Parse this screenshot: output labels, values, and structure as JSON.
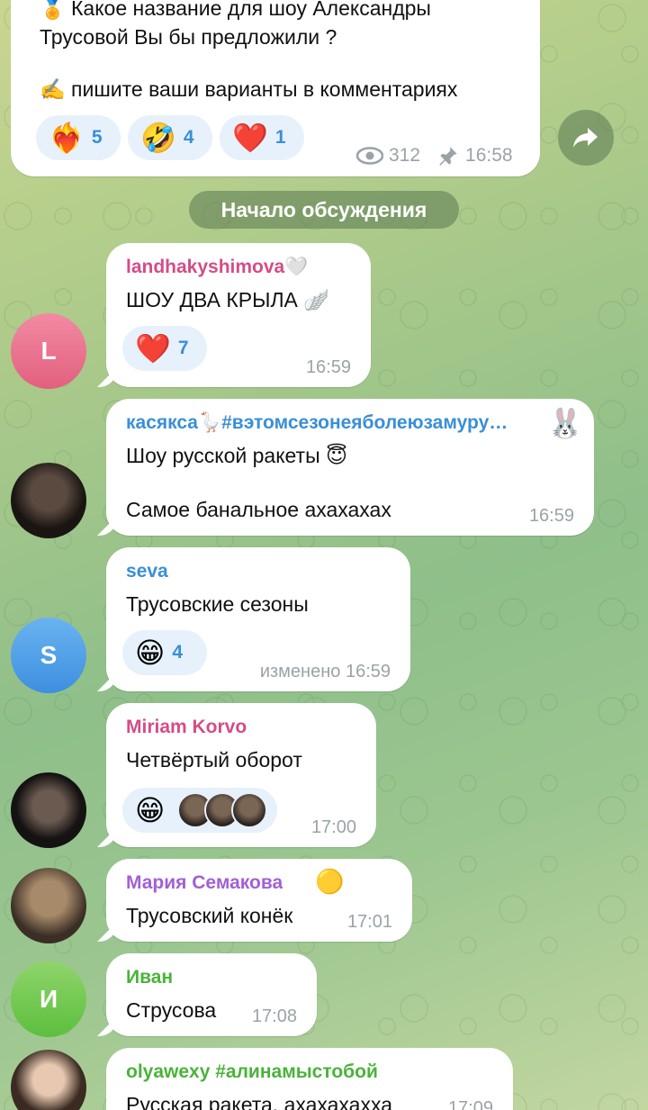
{
  "post": {
    "line1": "Какое название для шоу Александры",
    "line2": "Трусовой Вы бы предложили ?",
    "line3": "пишите ваши варианты в комментариях",
    "reactions": [
      {
        "emoji": "❤️‍🔥",
        "count": "5"
      },
      {
        "emoji": "🤣",
        "count": "4"
      },
      {
        "emoji": "❤️",
        "count": "1"
      }
    ],
    "views": "312",
    "time": "16:58"
  },
  "divider": "Начало обсуждения",
  "comments": [
    {
      "name": "landhakyshimova🤍",
      "text": "ШОУ ДВА КРЫЛА 🪽",
      "reaction_emoji": "❤️",
      "reaction_count": "7",
      "time": "16:59",
      "avatar_letter": "L",
      "name_color": "#d44c88"
    },
    {
      "name": "касякса🪿#вэтомсезонеяболеюзамуру…",
      "text1": "Шоу русской ракеты 😇",
      "text2": "Самое банальное ахахахах",
      "time": "16:59",
      "name_color": "#3a8fd6"
    },
    {
      "name": "seva",
      "text": "Трусовские сезоны",
      "reaction_emoji": "😁",
      "reaction_count": "4",
      "time": "изменено 16:59",
      "avatar_letter": "S",
      "name_color": "#3a8fd6"
    },
    {
      "name": "Miriam Korvo",
      "text": "Четвёртый оборот",
      "reaction_emoji": "😁",
      "time": "17:00",
      "name_color": "#d44c88"
    },
    {
      "name": "Мария Семакова",
      "text": "Трусовский конёк",
      "time": "17:01",
      "name_color": "#a25fd6"
    },
    {
      "name": "Иван",
      "text": "Струсова",
      "time": "17:08",
      "avatar_letter": "И",
      "name_color": "#4ab33a"
    },
    {
      "name": "olyawexy #алинамыстобой",
      "text": "Русская ракета, ахахахахха",
      "time": "17:09",
      "name_color": "#4ab33a"
    }
  ]
}
